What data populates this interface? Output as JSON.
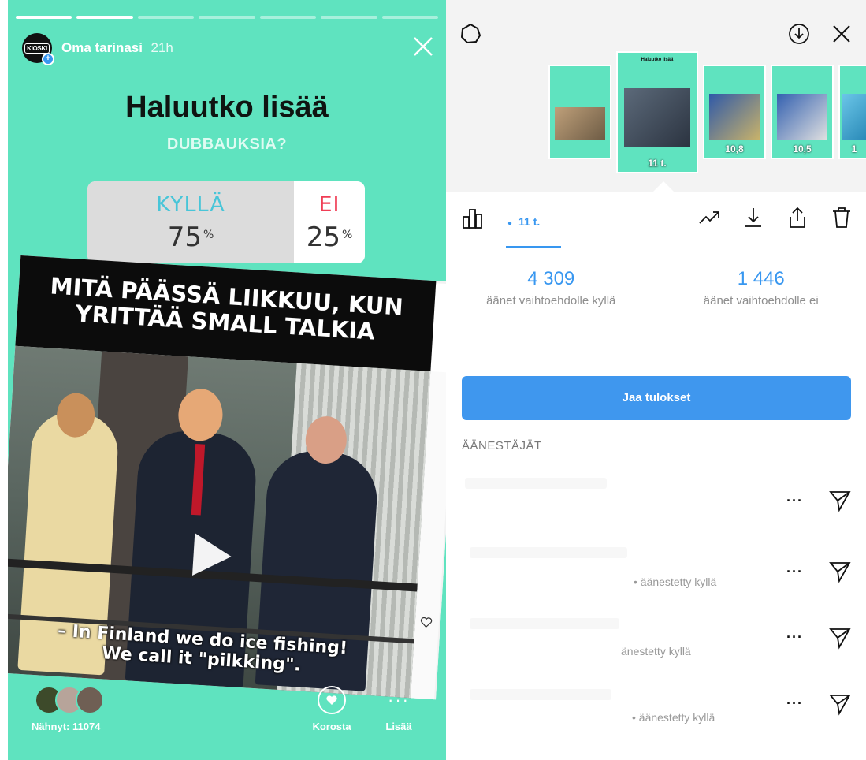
{
  "story": {
    "username": "Oma tarinasi",
    "time": "21h",
    "avatar_text": "KIOSKI",
    "question": "Haluutko lisää",
    "subtitle": "DUBBAUKSIA?",
    "poll": {
      "yes_label": "KYLLÄ",
      "yes_pct": "75",
      "no_label": "EI",
      "no_pct": "25",
      "pct_sign": "%"
    },
    "post": {
      "banner_line1": "MITÄ PÄÄSSÄ LIIKKUU, KUN",
      "banner_line2": "YRITTÄÄ SMALL TALKIA",
      "caption_line1": "– In Finland we do ice fishing!",
      "caption_line2": "We call it \"pilkking\"."
    },
    "footer": {
      "seen_text": "Nähnyt: 11074",
      "highlight_label": "Korosta",
      "more_label": "Lisää"
    },
    "icons": [
      "close-icon",
      "play-icon",
      "heart-outline-icon"
    ]
  },
  "insights": {
    "thumbnails": [
      {
        "count": ""
      },
      {
        "count": "11 t."
      },
      {
        "count": "10,8"
      },
      {
        "count": "10,5"
      },
      {
        "count": "1"
      }
    ],
    "views_label": "11 t.",
    "yes_votes": "4 309",
    "yes_votes_desc": "äänet vaihtoehdolle kyllä",
    "no_votes": "1 446",
    "no_votes_desc": "äänet vaihtoehdolle ei",
    "share_button": "Jaa tulokset",
    "voters_heading": "ÄÄNESTÄJÄT",
    "voters": [
      {
        "status": ""
      },
      {
        "status": "• äänestetty kyllä"
      },
      {
        "status": "änestetty kyllä"
      },
      {
        "status": "• äänestetty kyllä"
      }
    ],
    "more_glyph": "···",
    "icons": [
      "gear-icon",
      "download-icon",
      "close-icon",
      "bar-chart-icon",
      "eye-icon",
      "trending-icon",
      "save-icon",
      "share-icon",
      "trash-icon",
      "send-icon"
    ]
  },
  "colors": {
    "story_bg": "#5fe3bf",
    "accent_blue": "#3897f0",
    "yes_color": "#48c5d8",
    "no_color": "#f03d55"
  }
}
